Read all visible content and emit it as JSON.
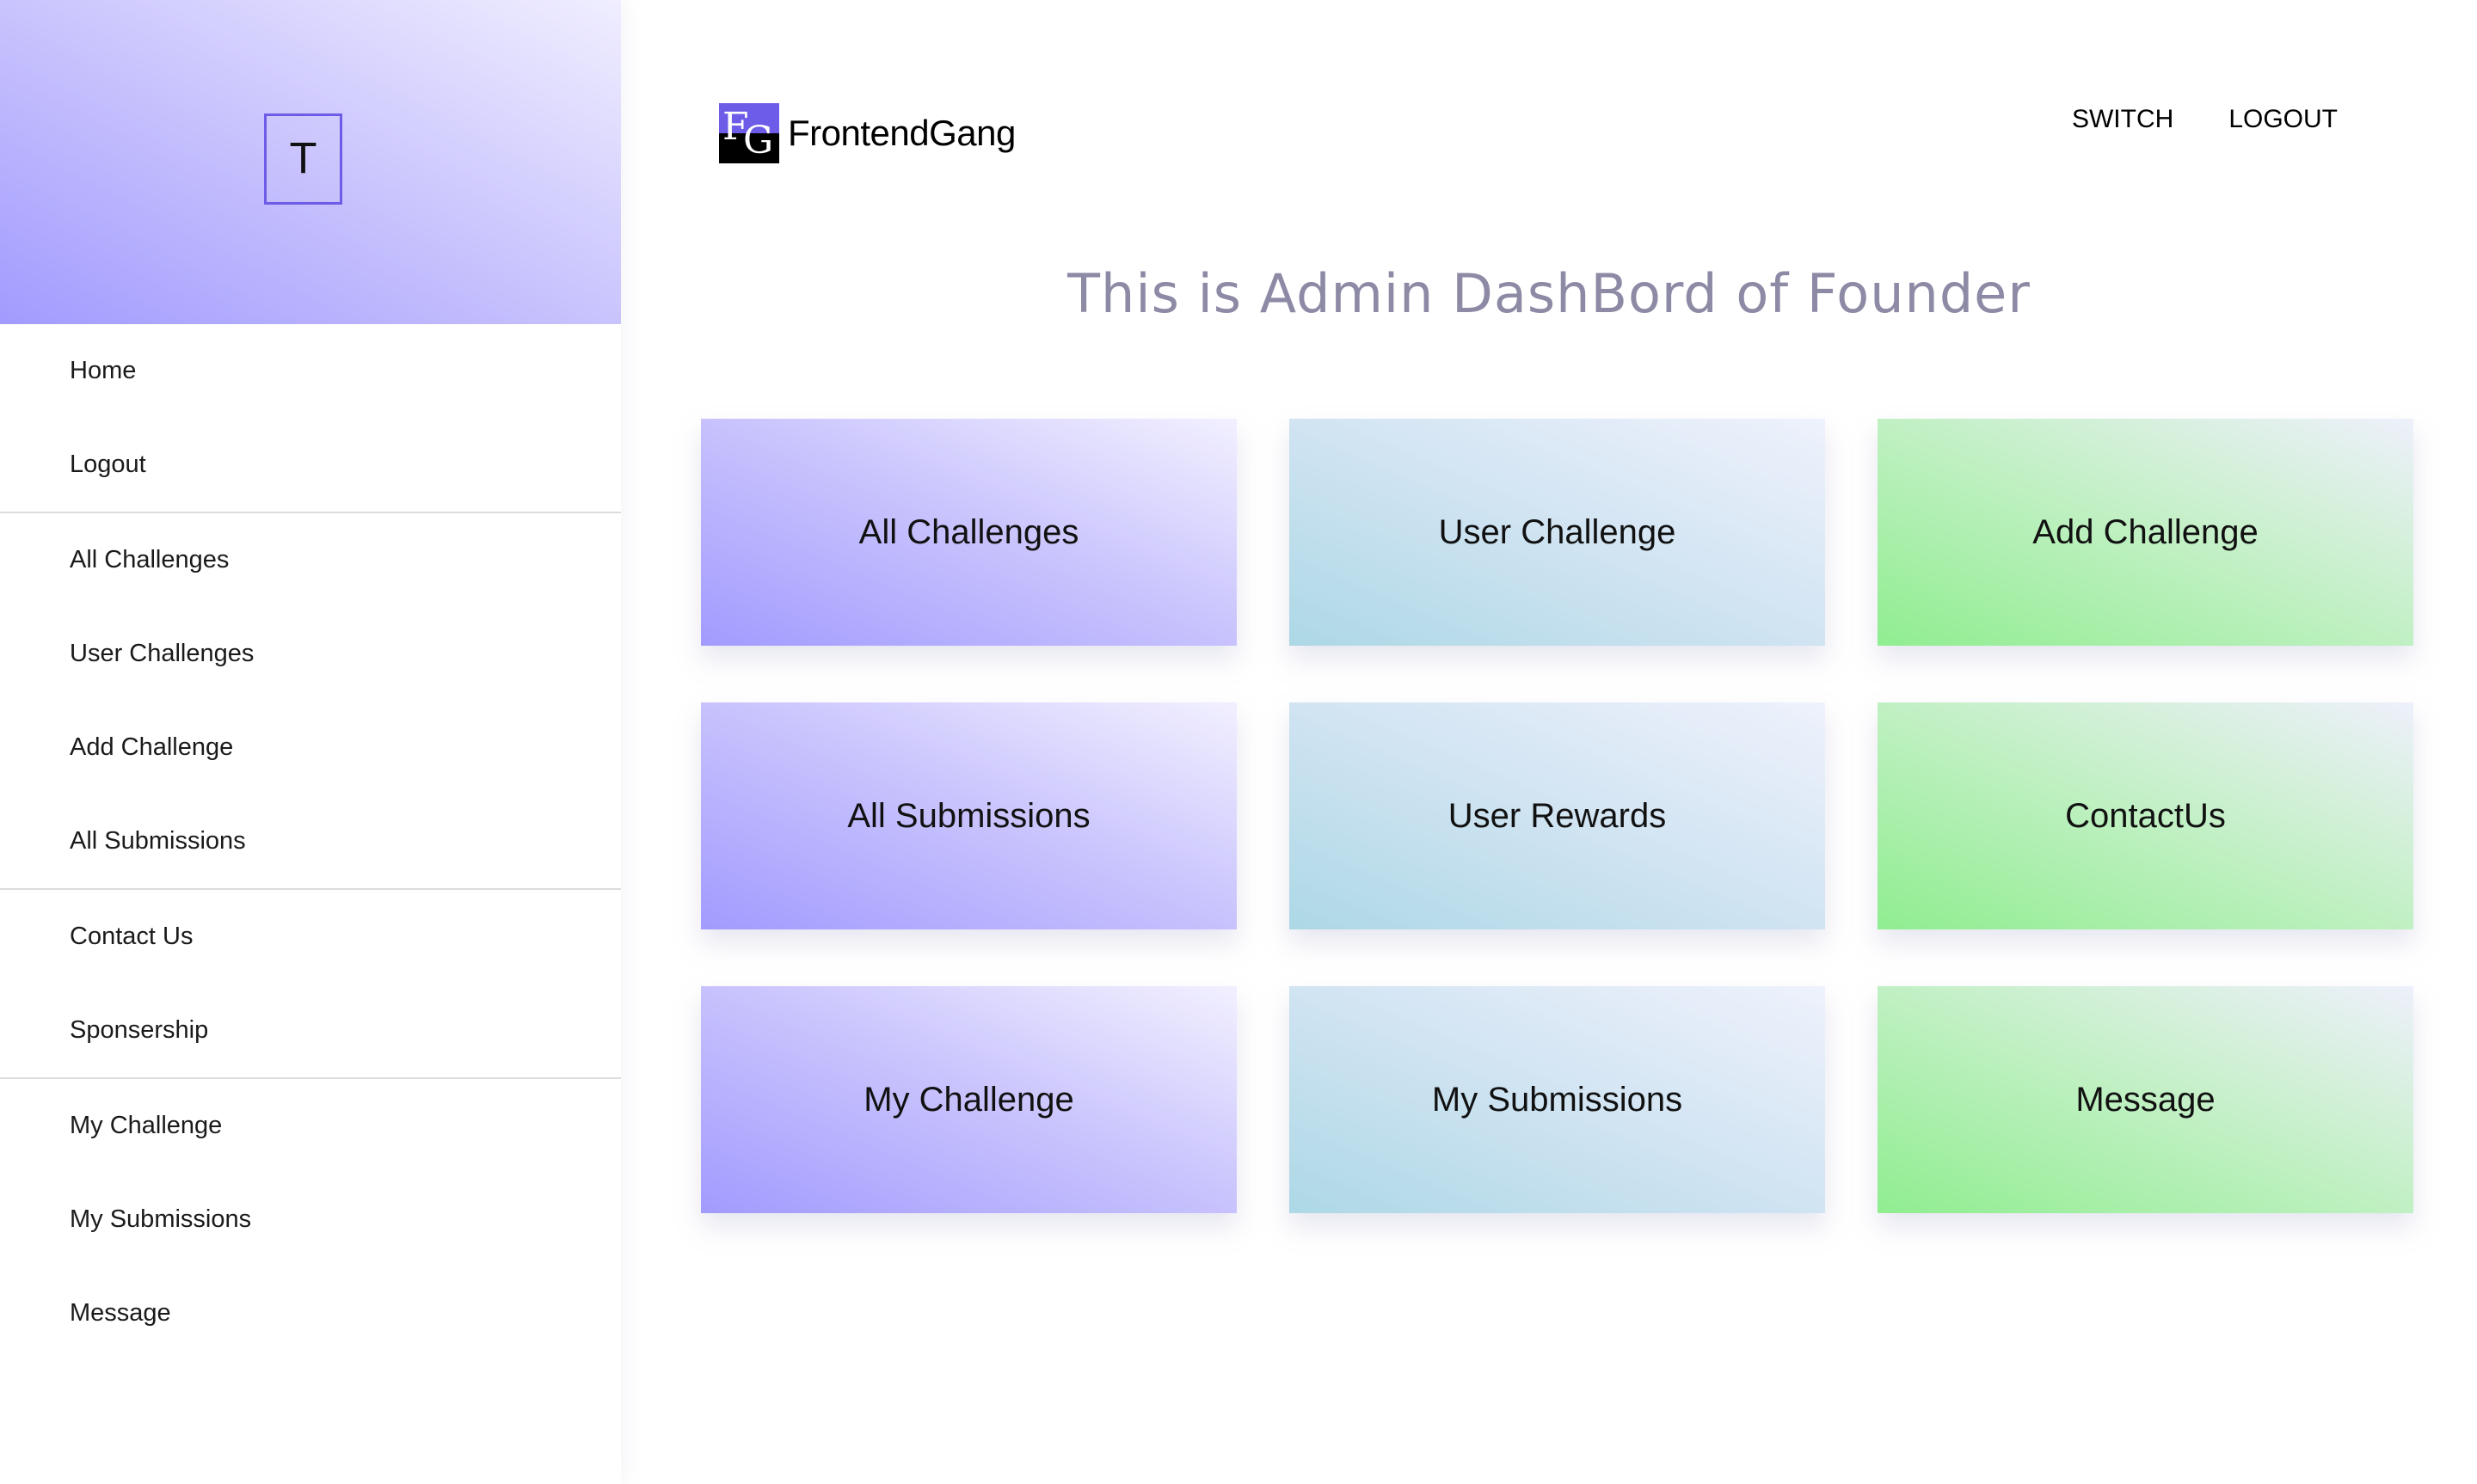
{
  "sidebar": {
    "avatar_letter": "T",
    "groups": [
      {
        "items": [
          {
            "label": "Home"
          },
          {
            "label": "Logout"
          }
        ]
      },
      {
        "items": [
          {
            "label": "All Challenges"
          },
          {
            "label": "User Challenges"
          },
          {
            "label": "Add Challenge"
          },
          {
            "label": "All Submissions"
          }
        ]
      },
      {
        "items": [
          {
            "label": "Contact Us"
          },
          {
            "label": "Sponsership"
          }
        ]
      },
      {
        "items": [
          {
            "label": "My Challenge"
          },
          {
            "label": "My Submissions"
          },
          {
            "label": "Message"
          }
        ]
      }
    ]
  },
  "header": {
    "logo_letters": [
      "F",
      "G"
    ],
    "brand_name": "FrontendGang",
    "switch_label": "SWITCH",
    "logout_label": "LOGOUT"
  },
  "main": {
    "title": "This is Admin DashBord of Founder",
    "cards": [
      {
        "label": "All Challenges",
        "color": "purple"
      },
      {
        "label": "User Challenge",
        "color": "blue"
      },
      {
        "label": "Add Challenge",
        "color": "green"
      },
      {
        "label": "All Submissions",
        "color": "purple"
      },
      {
        "label": "User Rewards",
        "color": "blue"
      },
      {
        "label": "ContactUs",
        "color": "green"
      },
      {
        "label": "My Challenge",
        "color": "purple"
      },
      {
        "label": "My Submissions",
        "color": "blue"
      },
      {
        "label": "Message",
        "color": "green"
      }
    ]
  },
  "colors": {
    "accent": "#6c5ce7",
    "purple": "#a29bfe",
    "blue": "#add8e6",
    "green": "#90ee90",
    "title_gray": "#8d8aa5"
  }
}
